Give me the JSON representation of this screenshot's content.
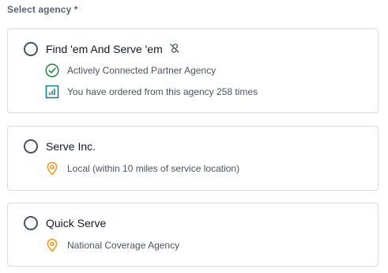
{
  "field": {
    "label": "Select agency *"
  },
  "agencies": [
    {
      "name": "Find 'em And Serve 'em",
      "badges": [
        {
          "icon": "check-circle-icon",
          "text": "Actively Connected Partner Agency",
          "color": "#2f8a4e"
        },
        {
          "icon": "chart-icon",
          "text": "You have ordered from this agency 258 times",
          "color": "#1f7f8f"
        }
      ],
      "name_icon": "unlink-icon",
      "selected": false
    },
    {
      "name": "Serve Inc.",
      "badges": [
        {
          "icon": "location-pin-icon",
          "text": "Local (within 10 miles of service location)",
          "color": "#f29a26"
        }
      ],
      "selected": false
    },
    {
      "name": "Quick Serve",
      "badges": [
        {
          "icon": "location-pin-icon",
          "text": "National Coverage Agency",
          "color": "#f29a26"
        }
      ],
      "selected": false
    }
  ]
}
